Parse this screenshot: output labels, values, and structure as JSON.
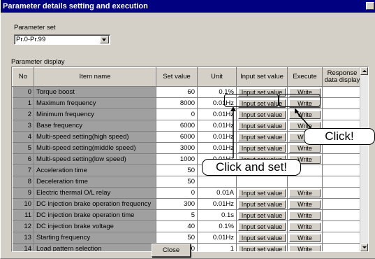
{
  "window": {
    "title": "Parameter details setting and execution"
  },
  "parameter_set": {
    "label": "Parameter set",
    "selected": "Pr.0-Pr.99"
  },
  "parameter_display": {
    "label": "Parameter display"
  },
  "table": {
    "headers": [
      "No",
      "Item name",
      "Set value",
      "Unit",
      "Input set value",
      "Execute",
      "Response data display"
    ],
    "rows": [
      {
        "no": "0",
        "name": "Torque boost",
        "value": "60",
        "unit": "0.1%",
        "input": "Input set value",
        "exec": "Write"
      },
      {
        "no": "1",
        "name": "Maximum frequency",
        "value": "8000",
        "unit": "0.01Hz",
        "input": "Input set value",
        "exec": "Write"
      },
      {
        "no": "2",
        "name": "Minimum frequency",
        "value": "0",
        "unit": "0.01Hz",
        "input": "Input set value",
        "exec": "Write"
      },
      {
        "no": "3",
        "name": "Base frequency",
        "value": "6000",
        "unit": "0.01Hz",
        "input": "Input set value",
        "exec": "Write"
      },
      {
        "no": "4",
        "name": "Multi-speed setting(high speed)",
        "value": "6000",
        "unit": "0.01Hz",
        "input": "Input set value",
        "exec": "Write"
      },
      {
        "no": "5",
        "name": "Multi-speed setting(middle speed)",
        "value": "3000",
        "unit": "0.01Hz",
        "input": "Input set value",
        "exec": "Write"
      },
      {
        "no": "6",
        "name": "Multi-speed setting(low speed)",
        "value": "1000",
        "unit": "0.01Hz",
        "input": "Input set value",
        "exec": "Write"
      },
      {
        "no": "7",
        "name": "Acceleration time",
        "value": "50",
        "unit": "",
        "input": "",
        "exec": ""
      },
      {
        "no": "8",
        "name": "Deceleration time",
        "value": "50",
        "unit": "",
        "input": "",
        "exec": ""
      },
      {
        "no": "9",
        "name": "Electric thermal O/L relay",
        "value": "0",
        "unit": "0.01A",
        "input": "Input set value",
        "exec": "Write"
      },
      {
        "no": "10",
        "name": "DC injection brake operation frequency",
        "value": "300",
        "unit": "0.01Hz",
        "input": "Input set value",
        "exec": "Write"
      },
      {
        "no": "11",
        "name": "DC injection brake operation time",
        "value": "5",
        "unit": "0.1s",
        "input": "Input set value",
        "exec": "Write"
      },
      {
        "no": "12",
        "name": "DC injection brake voltage",
        "value": "40",
        "unit": "0.1%",
        "input": "Input set value",
        "exec": "Write"
      },
      {
        "no": "13",
        "name": "Starting frequency",
        "value": "50",
        "unit": "0.01Hz",
        "input": "Input set value",
        "exec": "Write"
      },
      {
        "no": "14",
        "name": "Load pattern selection",
        "value": "0",
        "unit": "1",
        "input": "Input set value",
        "exec": "Write"
      }
    ]
  },
  "close_button": "Close",
  "callouts": {
    "click": "Click!",
    "click_and_set": "Click and set!"
  }
}
